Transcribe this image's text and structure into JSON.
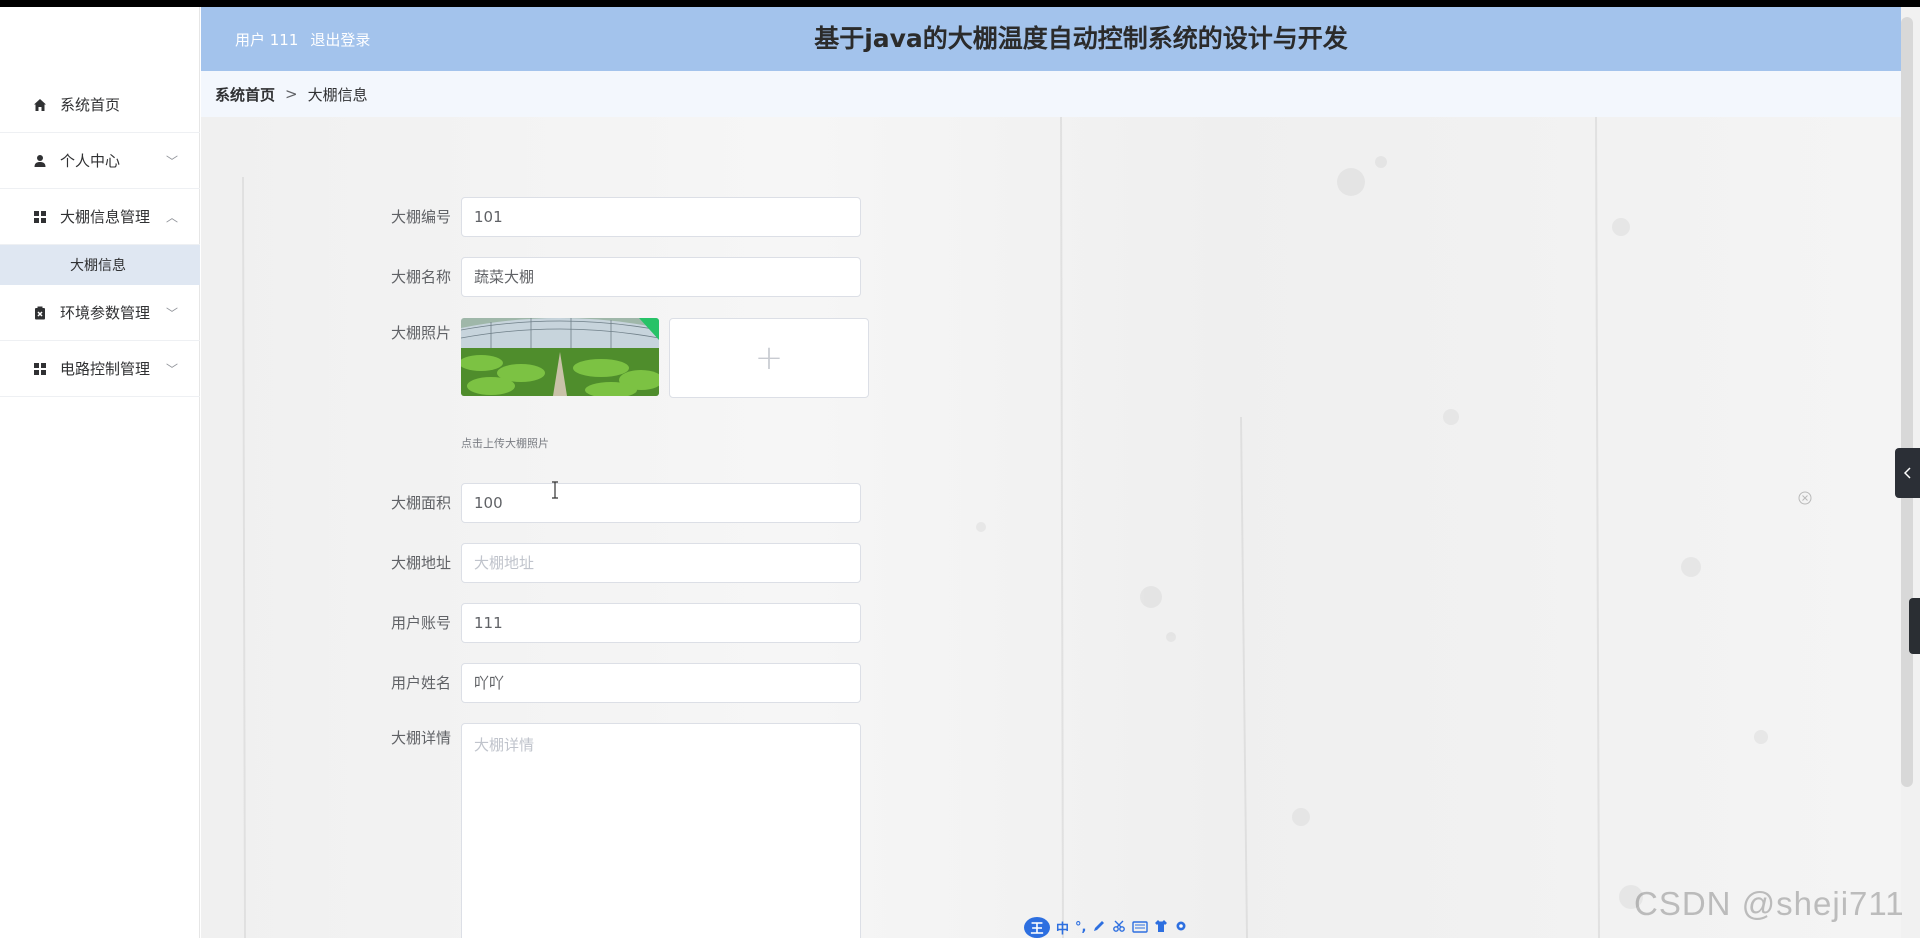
{
  "header": {
    "user_label": "用户 111",
    "logout_label": "退出登录",
    "title": "基于java的大棚温度自动控制系统的设计与开发"
  },
  "sidebar": {
    "items": [
      {
        "label": "系统首页",
        "icon": "home-icon"
      },
      {
        "label": "个人中心",
        "icon": "user-icon",
        "arrow": "﹀"
      },
      {
        "label": "大棚信息管理",
        "icon": "grid-icon",
        "arrow": "︿"
      },
      {
        "label": "环境参数管理",
        "icon": "clipboard-icon",
        "arrow": "﹀"
      },
      {
        "label": "电路控制管理",
        "icon": "grid-icon",
        "arrow": "﹀"
      }
    ],
    "sub_items": [
      {
        "label": "大棚信息"
      }
    ]
  },
  "breadcrumb": {
    "home": "系统首页",
    "separator": ">",
    "current": "大棚信息"
  },
  "form": {
    "number": {
      "label": "大棚编号",
      "value": "101"
    },
    "name": {
      "label": "大棚名称",
      "value": "蔬菜大棚"
    },
    "photo": {
      "label": "大棚照片",
      "upload_plus": "+",
      "tip": "点击上传大棚照片"
    },
    "area": {
      "label": "大棚面积",
      "value": "100"
    },
    "address": {
      "label": "大棚地址",
      "placeholder": "大棚地址"
    },
    "account": {
      "label": "用户账号",
      "value": "111"
    },
    "username": {
      "label": "用户姓名",
      "value": "吖吖"
    },
    "detail": {
      "label": "大棚详情",
      "placeholder": "大棚详情"
    }
  },
  "ime": {
    "logo": "王",
    "mode": "中",
    "punct": "°,"
  },
  "watermark": "CSDN @sheji711",
  "colors": {
    "header_bg": "#a3c3ec",
    "breadcrumb_bg": "#f3f7fd",
    "submenu_active_bg": "#dfe7f2"
  }
}
